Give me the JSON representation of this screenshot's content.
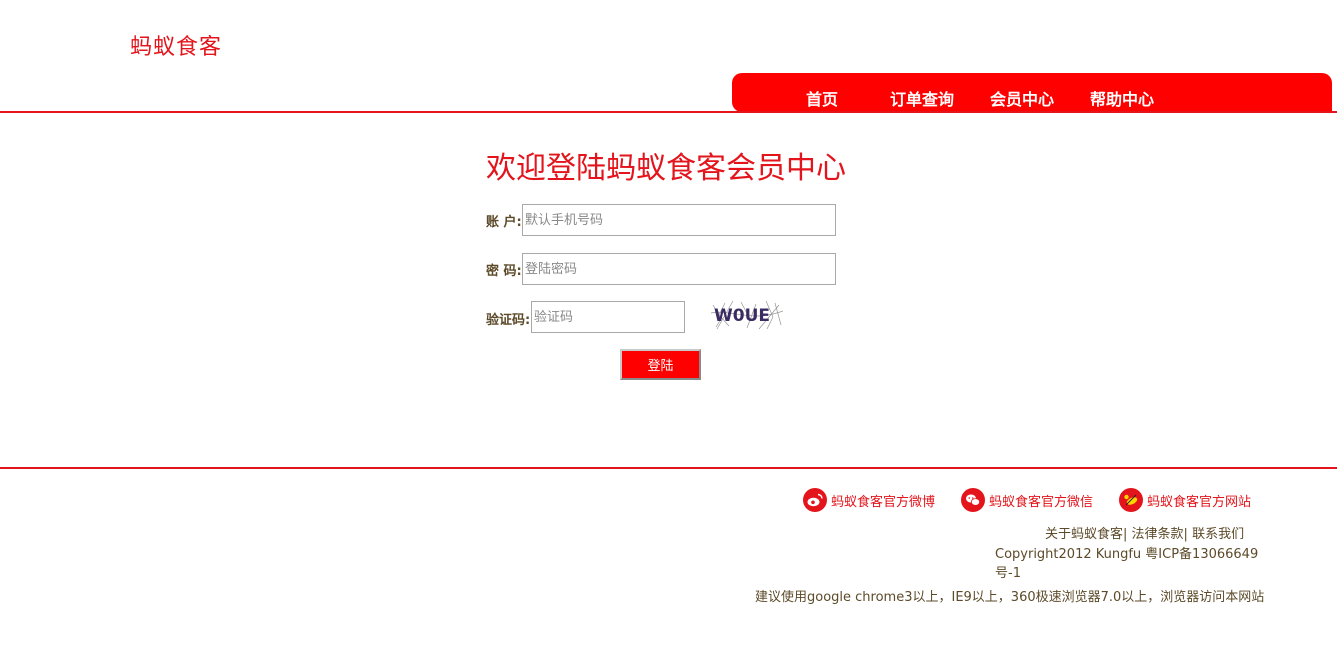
{
  "header": {
    "logo": "蚂蚁食客",
    "nav": [
      "首页",
      "订单查询",
      "会员中心",
      "帮助中心"
    ]
  },
  "login": {
    "title": "欢迎登陆蚂蚁食客会员中心",
    "account_label": "账 户:",
    "account_placeholder": "默认手机号码",
    "password_label": "密 码:",
    "password_placeholder": "登陆密码",
    "captcha_label": "验证码:",
    "captcha_placeholder": "验证码",
    "captcha_text": "W0UE",
    "submit": "登陆"
  },
  "footer": {
    "social": [
      "蚂蚁食客官方微博",
      "蚂蚁食客官方微信",
      "蚂蚁食客官方网站"
    ],
    "links": [
      "关于蚂蚁食客",
      "法律条款",
      "联系我们"
    ],
    "copyright": "Copyright2012 Kungfu 粤ICP备13066649号-1",
    "browser_note": "建议使用google chrome3以上，IE9以上，360极速浏览器7.0以上，浏览器访问本网站"
  },
  "colors": {
    "brand_red": "#e3141b",
    "nav_bg": "#ff0000",
    "text_brown": "#5c4a29"
  },
  "icons": [
    "weibo-icon",
    "wechat-icon",
    "website-icon"
  ]
}
